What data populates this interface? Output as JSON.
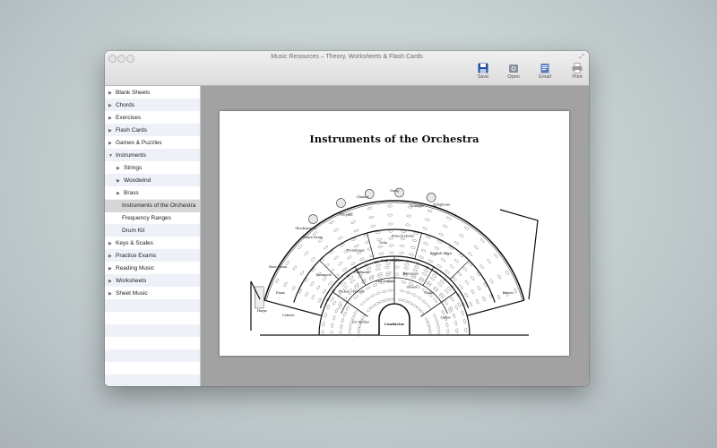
{
  "window": {
    "title": "Music Resources – Theory, Worksheets & Flash Cards",
    "toolbar": {
      "save": "Save",
      "open": "Open",
      "email": "Email",
      "print": "Print"
    }
  },
  "sidebar": {
    "items": [
      {
        "label": "Blank Sheets",
        "level": 0,
        "expandable": true,
        "expanded": false
      },
      {
        "label": "Chords",
        "level": 0,
        "expandable": true,
        "expanded": false
      },
      {
        "label": "Exercises",
        "level": 0,
        "expandable": true,
        "expanded": false
      },
      {
        "label": "Flash Cards",
        "level": 0,
        "expandable": true,
        "expanded": false
      },
      {
        "label": "Games & Puzzles",
        "level": 0,
        "expandable": true,
        "expanded": false
      },
      {
        "label": "Instruments",
        "level": 0,
        "expandable": true,
        "expanded": true
      },
      {
        "label": "Strings",
        "level": 1,
        "expandable": true,
        "expanded": false
      },
      {
        "label": "Woodwind",
        "level": 1,
        "expandable": true,
        "expanded": false
      },
      {
        "label": "Brass",
        "level": 1,
        "expandable": true,
        "expanded": false
      },
      {
        "label": "Instruments of the Orchestra",
        "level": 1,
        "expandable": false,
        "selected": true
      },
      {
        "label": "Frequency Ranges",
        "level": 1,
        "expandable": false
      },
      {
        "label": "Drum Kit",
        "level": 1,
        "expandable": false
      },
      {
        "label": "Keys & Scales",
        "level": 0,
        "expandable": true,
        "expanded": false
      },
      {
        "label": "Practice Exams",
        "level": 0,
        "expandable": true,
        "expanded": false
      },
      {
        "label": "Reading Music",
        "level": 0,
        "expandable": true,
        "expanded": false
      },
      {
        "label": "Worksheets",
        "level": 0,
        "expandable": true,
        "expanded": false
      },
      {
        "label": "Sheet Music",
        "level": 0,
        "expandable": true,
        "expanded": false
      }
    ]
  },
  "document": {
    "title": "Instruments of the Orchestra",
    "labels": {
      "conductor": "Conductor",
      "first_violins": "1st Violins",
      "second_violins": "2nd Violins",
      "violas": "Violas",
      "cellos": "Cellos",
      "basses": "Basses",
      "harp": "Harps",
      "piano": "Piano",
      "celeste": "Celeste",
      "bass_drum": "Bass Drum",
      "snare_drum": "Snare Drum",
      "glockenspiel": "Glockenspiel",
      "chimes": "Chimes",
      "gong": "Gong",
      "timpani": "Timpani",
      "xylophone": "Xylophone",
      "triangle": "Triangle",
      "flutes": "Flutes",
      "piccolo": "Piccolo",
      "oboes": "Oboes",
      "clarinets": "Clarinets",
      "bassoons": "Bassoons",
      "bass_clarinet": "Bass Clarinet",
      "trumpets": "Trumpets",
      "trombones": "Trombones",
      "tuba": "Tuba",
      "french_horns": "French Horns",
      "english_horn": "English Horn"
    }
  }
}
